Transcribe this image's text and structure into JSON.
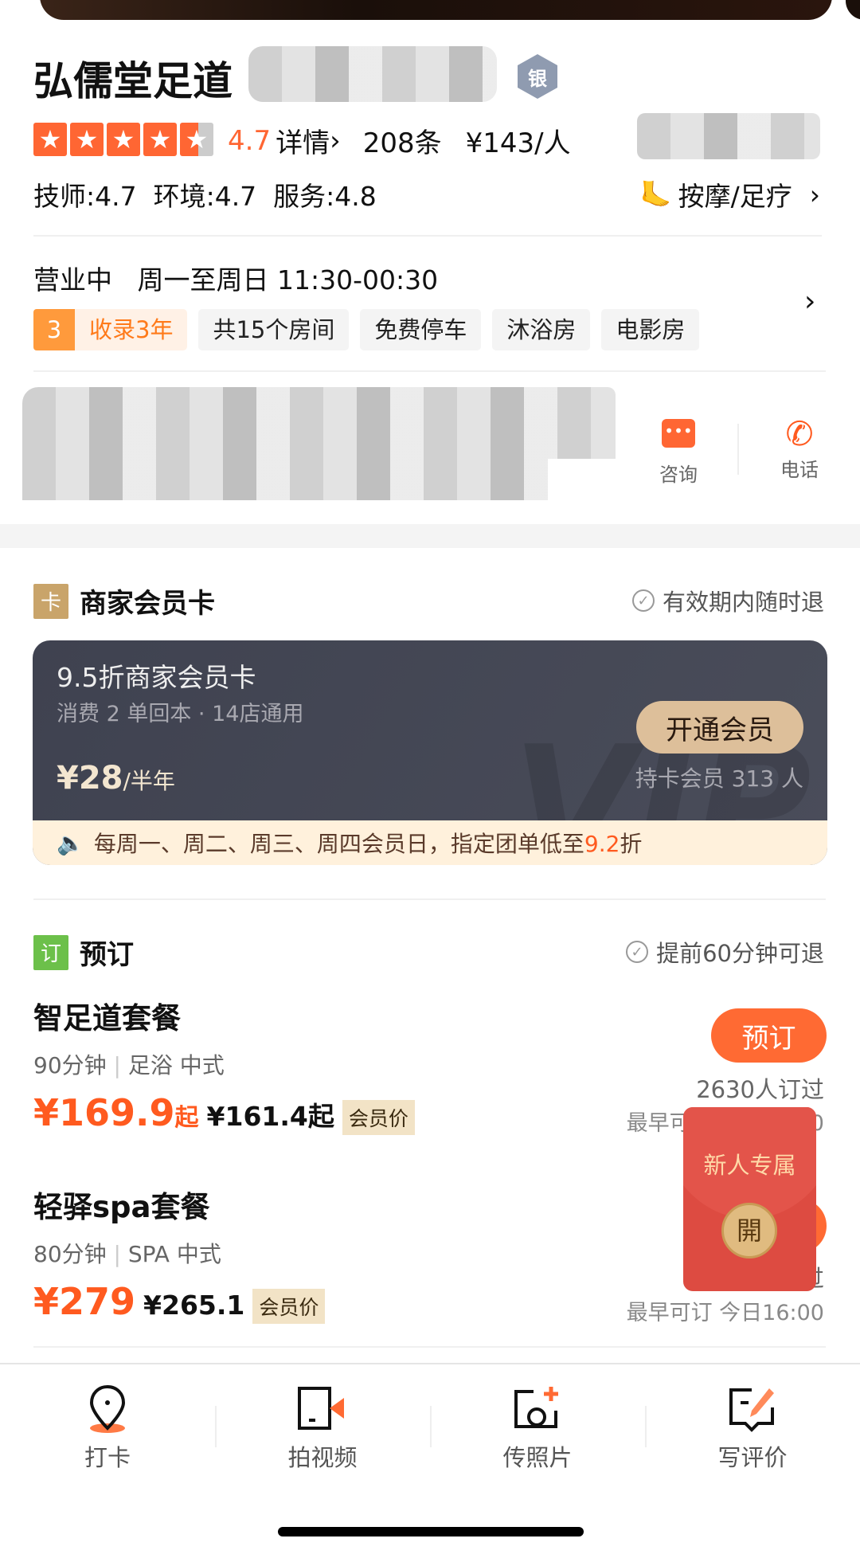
{
  "shop": {
    "name": "弘儒堂足道",
    "medal": "银",
    "rating": "4.7",
    "detail": "详情",
    "reviews": "208条",
    "price_per": "¥143/人",
    "subscores": "技师:4.7  环境:4.7  服务:4.8",
    "category": "按摩/足疗",
    "star_fraction": 0.94
  },
  "hours": {
    "status": "营业中",
    "text": "周一至周日 11:30-00:30"
  },
  "tags": {
    "year_badge": "3",
    "year": "收录3年",
    "items": [
      "共15个房间",
      "免费停车",
      "沐浴房",
      "电影房"
    ]
  },
  "actions": {
    "consult": "咨询",
    "phone": "电话"
  },
  "member": {
    "header": "商家会员卡",
    "header_icon": "卡",
    "guarantee": "有效期内随时退",
    "card_title": "9.5折商家会员卡",
    "card_sub": "消费 2 单回本 · 14店通用",
    "price": "¥28",
    "period": "/半年",
    "open": "开通会员",
    "holders": "持卡会员 313 人",
    "watermark": "VIP",
    "notice_pre": "每周一、周二、周三、周四会员日，指定团单低至",
    "notice_num": "9.2",
    "notice_post": "折"
  },
  "booking": {
    "header": "预订",
    "header_icon": "订",
    "guarantee": "提前60分钟可退",
    "items": [
      {
        "name": "智足道套餐",
        "meta1": "90分钟",
        "meta2": "足浴 中式",
        "price": "¥169.9",
        "price_suffix": "起",
        "member_price": "¥161.4起",
        "member_tag": "会员价",
        "button": "预订",
        "sold": "2630人订过",
        "earliest": "最早可订 今日16:00"
      },
      {
        "name": "轻驿spa套餐",
        "meta1": "80分钟",
        "meta2": "SPA 中式",
        "price": "¥279",
        "price_suffix": "",
        "member_price": "¥265.1",
        "member_tag": "会员价",
        "button": "预订",
        "sold_fragment": "过",
        "earliest": "最早可订 今日16:00"
      }
    ]
  },
  "envelope": {
    "title": "新人专属",
    "open": "開"
  },
  "nav": [
    {
      "label": "打卡",
      "icon": "location-pin-icon"
    },
    {
      "label": "拍视频",
      "icon": "video-icon"
    },
    {
      "label": "传照片",
      "icon": "camera-plus-icon"
    },
    {
      "label": "写评价",
      "icon": "write-review-icon"
    }
  ],
  "colors": {
    "accent": "#ff6633",
    "gold": "#ddbf9a",
    "card": "#43465a",
    "envelope": "#dd4b41"
  }
}
